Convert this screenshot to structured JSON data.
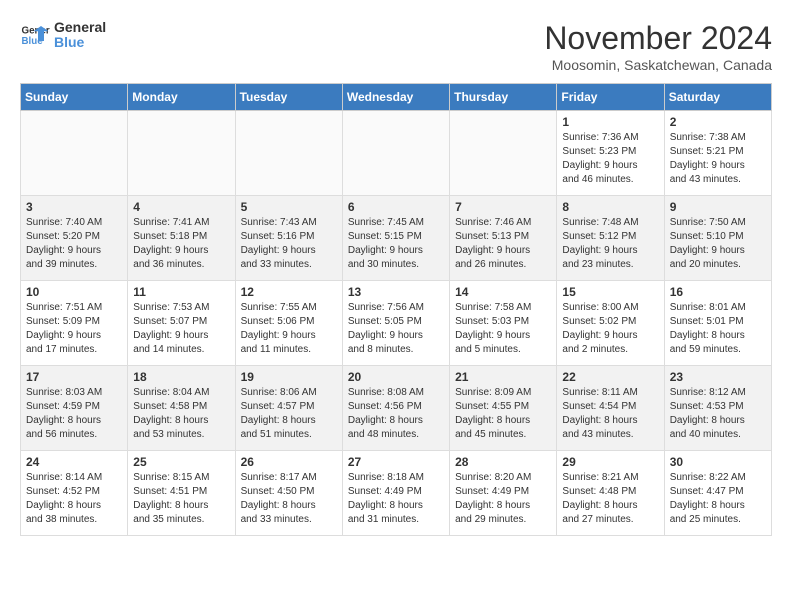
{
  "logo": {
    "line1": "General",
    "line2": "Blue"
  },
  "title": "November 2024",
  "location": "Moosomin, Saskatchewan, Canada",
  "days_of_week": [
    "Sunday",
    "Monday",
    "Tuesday",
    "Wednesday",
    "Thursday",
    "Friday",
    "Saturday"
  ],
  "weeks": [
    [
      {
        "day": "",
        "info": ""
      },
      {
        "day": "",
        "info": ""
      },
      {
        "day": "",
        "info": ""
      },
      {
        "day": "",
        "info": ""
      },
      {
        "day": "",
        "info": ""
      },
      {
        "day": "1",
        "info": "Sunrise: 7:36 AM\nSunset: 5:23 PM\nDaylight: 9 hours\nand 46 minutes."
      },
      {
        "day": "2",
        "info": "Sunrise: 7:38 AM\nSunset: 5:21 PM\nDaylight: 9 hours\nand 43 minutes."
      }
    ],
    [
      {
        "day": "3",
        "info": "Sunrise: 7:40 AM\nSunset: 5:20 PM\nDaylight: 9 hours\nand 39 minutes."
      },
      {
        "day": "4",
        "info": "Sunrise: 7:41 AM\nSunset: 5:18 PM\nDaylight: 9 hours\nand 36 minutes."
      },
      {
        "day": "5",
        "info": "Sunrise: 7:43 AM\nSunset: 5:16 PM\nDaylight: 9 hours\nand 33 minutes."
      },
      {
        "day": "6",
        "info": "Sunrise: 7:45 AM\nSunset: 5:15 PM\nDaylight: 9 hours\nand 30 minutes."
      },
      {
        "day": "7",
        "info": "Sunrise: 7:46 AM\nSunset: 5:13 PM\nDaylight: 9 hours\nand 26 minutes."
      },
      {
        "day": "8",
        "info": "Sunrise: 7:48 AM\nSunset: 5:12 PM\nDaylight: 9 hours\nand 23 minutes."
      },
      {
        "day": "9",
        "info": "Sunrise: 7:50 AM\nSunset: 5:10 PM\nDaylight: 9 hours\nand 20 minutes."
      }
    ],
    [
      {
        "day": "10",
        "info": "Sunrise: 7:51 AM\nSunset: 5:09 PM\nDaylight: 9 hours\nand 17 minutes."
      },
      {
        "day": "11",
        "info": "Sunrise: 7:53 AM\nSunset: 5:07 PM\nDaylight: 9 hours\nand 14 minutes."
      },
      {
        "day": "12",
        "info": "Sunrise: 7:55 AM\nSunset: 5:06 PM\nDaylight: 9 hours\nand 11 minutes."
      },
      {
        "day": "13",
        "info": "Sunrise: 7:56 AM\nSunset: 5:05 PM\nDaylight: 9 hours\nand 8 minutes."
      },
      {
        "day": "14",
        "info": "Sunrise: 7:58 AM\nSunset: 5:03 PM\nDaylight: 9 hours\nand 5 minutes."
      },
      {
        "day": "15",
        "info": "Sunrise: 8:00 AM\nSunset: 5:02 PM\nDaylight: 9 hours\nand 2 minutes."
      },
      {
        "day": "16",
        "info": "Sunrise: 8:01 AM\nSunset: 5:01 PM\nDaylight: 8 hours\nand 59 minutes."
      }
    ],
    [
      {
        "day": "17",
        "info": "Sunrise: 8:03 AM\nSunset: 4:59 PM\nDaylight: 8 hours\nand 56 minutes."
      },
      {
        "day": "18",
        "info": "Sunrise: 8:04 AM\nSunset: 4:58 PM\nDaylight: 8 hours\nand 53 minutes."
      },
      {
        "day": "19",
        "info": "Sunrise: 8:06 AM\nSunset: 4:57 PM\nDaylight: 8 hours\nand 51 minutes."
      },
      {
        "day": "20",
        "info": "Sunrise: 8:08 AM\nSunset: 4:56 PM\nDaylight: 8 hours\nand 48 minutes."
      },
      {
        "day": "21",
        "info": "Sunrise: 8:09 AM\nSunset: 4:55 PM\nDaylight: 8 hours\nand 45 minutes."
      },
      {
        "day": "22",
        "info": "Sunrise: 8:11 AM\nSunset: 4:54 PM\nDaylight: 8 hours\nand 43 minutes."
      },
      {
        "day": "23",
        "info": "Sunrise: 8:12 AM\nSunset: 4:53 PM\nDaylight: 8 hours\nand 40 minutes."
      }
    ],
    [
      {
        "day": "24",
        "info": "Sunrise: 8:14 AM\nSunset: 4:52 PM\nDaylight: 8 hours\nand 38 minutes."
      },
      {
        "day": "25",
        "info": "Sunrise: 8:15 AM\nSunset: 4:51 PM\nDaylight: 8 hours\nand 35 minutes."
      },
      {
        "day": "26",
        "info": "Sunrise: 8:17 AM\nSunset: 4:50 PM\nDaylight: 8 hours\nand 33 minutes."
      },
      {
        "day": "27",
        "info": "Sunrise: 8:18 AM\nSunset: 4:49 PM\nDaylight: 8 hours\nand 31 minutes."
      },
      {
        "day": "28",
        "info": "Sunrise: 8:20 AM\nSunset: 4:49 PM\nDaylight: 8 hours\nand 29 minutes."
      },
      {
        "day": "29",
        "info": "Sunrise: 8:21 AM\nSunset: 4:48 PM\nDaylight: 8 hours\nand 27 minutes."
      },
      {
        "day": "30",
        "info": "Sunrise: 8:22 AM\nSunset: 4:47 PM\nDaylight: 8 hours\nand 25 minutes."
      }
    ]
  ]
}
